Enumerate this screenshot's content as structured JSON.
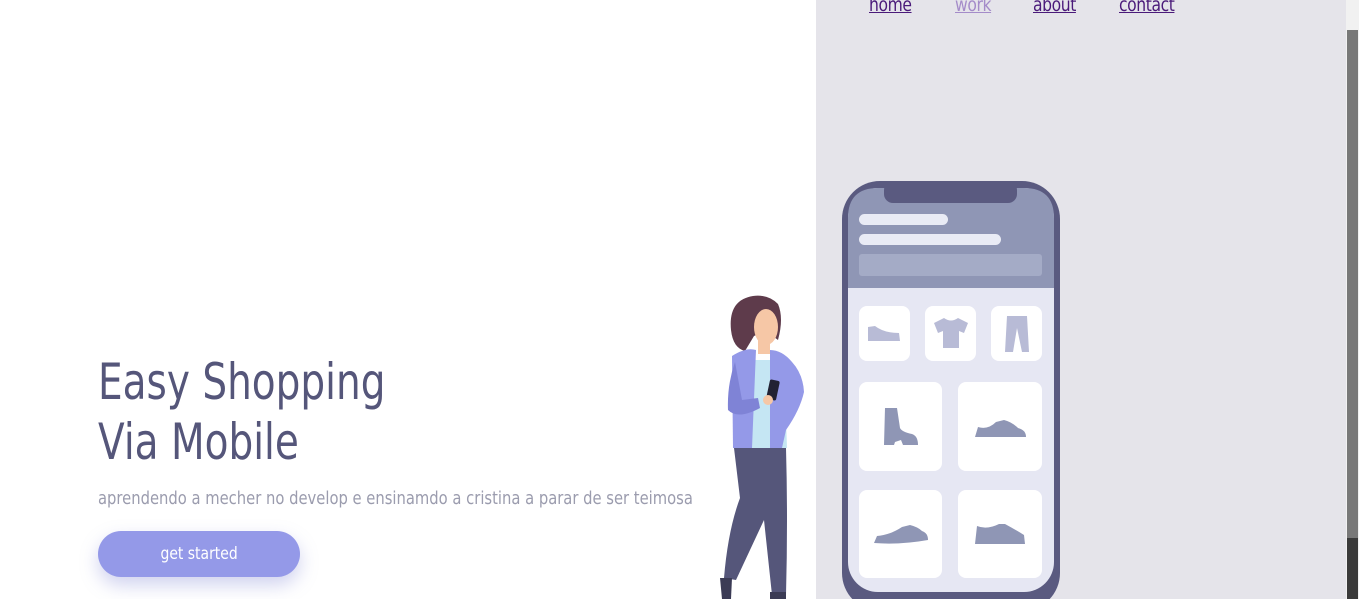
{
  "nav": {
    "items": [
      {
        "label": "home"
      },
      {
        "label": "work"
      },
      {
        "label": "about"
      },
      {
        "label": "contact"
      }
    ]
  },
  "hero": {
    "title_line1": "Easy Shopping",
    "title_line2": "Via Mobile",
    "subtitle": "aprendendo a mecher no develop e ensinamdo a cristina a parar de ser teimosa",
    "cta_label": "get started"
  },
  "colors": {
    "accent": "#9499e8",
    "title": "#55567a",
    "panel_bg": "#e5e4ea",
    "phone_frame": "#5a5a80"
  },
  "illustration": {
    "product_icons": [
      "shoe-icon",
      "tshirt-icon",
      "pants-icon",
      "boot-icon",
      "sneaker-icon",
      "sneaker-icon",
      "sneaker-icon"
    ]
  }
}
